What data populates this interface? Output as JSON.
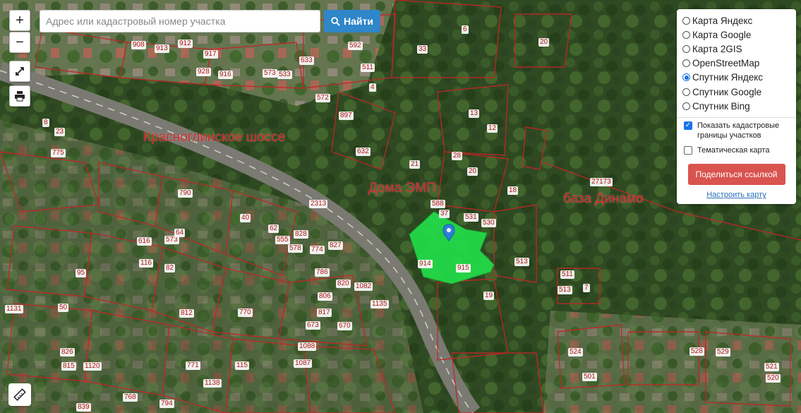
{
  "search": {
    "placeholder": "Адрес или кадастровый номер участка",
    "button_label": "Найти"
  },
  "zoom": {
    "in_label": "+",
    "out_label": "−"
  },
  "map_labels": {
    "road": "Красноглинское шоссе",
    "houses": "Дома ЭМП",
    "base": "база Динамо"
  },
  "parcels": [
    "908",
    "913",
    "912",
    "917",
    "533",
    "633",
    "592",
    "511",
    "928",
    "916",
    "573",
    "572",
    "897",
    "775",
    "632",
    "21",
    "20",
    "27173",
    "2313",
    "588",
    "37",
    "531",
    "530",
    "19",
    "914",
    "915",
    "513",
    "511",
    "513",
    "7",
    "790",
    "573",
    "616",
    "578",
    "555",
    "828",
    "827",
    "774",
    "786",
    "806",
    "817",
    "820",
    "673",
    "670",
    "1082",
    "1135",
    "1131",
    "812",
    "806",
    "770",
    "771",
    "1088",
    "1087",
    "115",
    "1138",
    "1120",
    "826",
    "815",
    "794",
    "768",
    "839",
    "524",
    "501",
    "528",
    "521",
    "520",
    "529",
    "4",
    "8",
    "6",
    "12",
    "13",
    "18",
    "23",
    "28",
    "33",
    "40",
    "50",
    "62",
    "64",
    "82",
    "95",
    "116",
    "20"
  ],
  "panel": {
    "layers": [
      {
        "label": "Карта Яндекс",
        "selected": false
      },
      {
        "label": "Карта Google",
        "selected": false
      },
      {
        "label": "Карта 2GIS",
        "selected": false
      },
      {
        "label": "OpenStreetMap",
        "selected": false
      },
      {
        "label": "Спутник Яндекс",
        "selected": true
      },
      {
        "label": "Спутник Google",
        "selected": false
      },
      {
        "label": "Спутник Bing",
        "selected": false
      }
    ],
    "cadastral_label": "Показать кадастровые границы участков",
    "cadastral_checked": true,
    "thematic_label": "Тематическая карта",
    "thematic_checked": false,
    "share_label": "Поделиться ссылкой",
    "setup_label": "Настроить карту"
  },
  "colors": {
    "accent": "#2f86c8",
    "share": "#d9534f",
    "parcel_line": "#c22626",
    "highlight": "#22e04a"
  }
}
